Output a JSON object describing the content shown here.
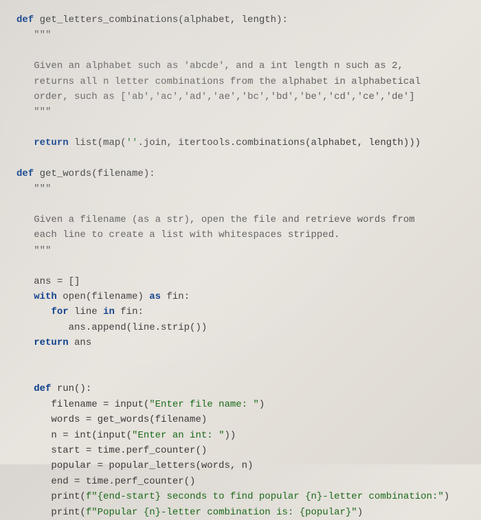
{
  "code": {
    "lines": [
      {
        "indent": 0,
        "tokens": [
          {
            "t": "def ",
            "c": "kw"
          },
          {
            "t": "get_letters_combinations(alphabet, length):",
            "c": "fn"
          }
        ]
      },
      {
        "indent": 1,
        "tokens": [
          {
            "t": "\"\"\"",
            "c": "docstr"
          }
        ]
      },
      {
        "indent": 0,
        "tokens": [
          {
            "t": "",
            "c": ""
          }
        ]
      },
      {
        "indent": 1,
        "tokens": [
          {
            "t": "Given an alphabet such as 'abcde', and a int length n such as 2,",
            "c": "docstr"
          }
        ]
      },
      {
        "indent": 1,
        "tokens": [
          {
            "t": "returns all n letter combinations from the alphabet in alphabetical",
            "c": "docstr"
          }
        ]
      },
      {
        "indent": 1,
        "tokens": [
          {
            "t": "order, such as ['ab','ac','ad','ae','bc','bd','be','cd','ce','de']",
            "c": "docstr"
          }
        ]
      },
      {
        "indent": 1,
        "tokens": [
          {
            "t": "\"\"\"",
            "c": "docstr"
          }
        ]
      },
      {
        "indent": 0,
        "tokens": [
          {
            "t": "",
            "c": ""
          }
        ]
      },
      {
        "indent": 1,
        "tokens": [
          {
            "t": "return ",
            "c": "kw"
          },
          {
            "t": "list(map(",
            "c": "fn"
          },
          {
            "t": "''",
            "c": "str"
          },
          {
            "t": ".join, itertools.combinations(alphabet, length)))",
            "c": "fn"
          }
        ]
      },
      {
        "indent": 0,
        "tokens": [
          {
            "t": "",
            "c": ""
          }
        ]
      },
      {
        "indent": 0,
        "tokens": [
          {
            "t": "def ",
            "c": "kw"
          },
          {
            "t": "get_words(filename):",
            "c": "fn"
          }
        ]
      },
      {
        "indent": 1,
        "tokens": [
          {
            "t": "\"\"\"",
            "c": "docstr"
          }
        ]
      },
      {
        "indent": 0,
        "tokens": [
          {
            "t": "",
            "c": ""
          }
        ]
      },
      {
        "indent": 1,
        "tokens": [
          {
            "t": "Given a filename (as a str), open the file and retrieve words from",
            "c": "docstr"
          }
        ]
      },
      {
        "indent": 1,
        "tokens": [
          {
            "t": "each line to create a list with whitespaces stripped.",
            "c": "docstr"
          }
        ]
      },
      {
        "indent": 1,
        "tokens": [
          {
            "t": "\"\"\"",
            "c": "docstr"
          }
        ]
      },
      {
        "indent": 0,
        "tokens": [
          {
            "t": "",
            "c": ""
          }
        ]
      },
      {
        "indent": 1,
        "tokens": [
          {
            "t": "ans = []",
            "c": "fn"
          }
        ]
      },
      {
        "indent": 1,
        "tokens": [
          {
            "t": "with ",
            "c": "kw"
          },
          {
            "t": "open(filename) ",
            "c": "fn"
          },
          {
            "t": "as ",
            "c": "kw"
          },
          {
            "t": "fin:",
            "c": "fn"
          }
        ]
      },
      {
        "indent": 2,
        "tokens": [
          {
            "t": "for ",
            "c": "kw"
          },
          {
            "t": "line ",
            "c": "fn"
          },
          {
            "t": "in ",
            "c": "kw"
          },
          {
            "t": "fin:",
            "c": "fn"
          }
        ]
      },
      {
        "indent": 3,
        "tokens": [
          {
            "t": "ans.append(line.strip())",
            "c": "fn"
          }
        ]
      },
      {
        "indent": 1,
        "tokens": [
          {
            "t": "return ",
            "c": "kw"
          },
          {
            "t": "ans",
            "c": "fn"
          }
        ]
      },
      {
        "indent": 0,
        "tokens": [
          {
            "t": "",
            "c": ""
          }
        ]
      },
      {
        "indent": 0,
        "tokens": [
          {
            "t": "",
            "c": ""
          }
        ]
      },
      {
        "indent": 1,
        "tokens": [
          {
            "t": "def ",
            "c": "kw"
          },
          {
            "t": "run():",
            "c": "fn"
          }
        ]
      },
      {
        "indent": 2,
        "tokens": [
          {
            "t": "filename = input(",
            "c": "fn"
          },
          {
            "t": "\"Enter file name: \"",
            "c": "str"
          },
          {
            "t": ")",
            "c": "fn"
          }
        ]
      },
      {
        "indent": 2,
        "tokens": [
          {
            "t": "words = get_words(filename)",
            "c": "fn"
          }
        ]
      },
      {
        "indent": 2,
        "tokens": [
          {
            "t": "n = int(input(",
            "c": "fn"
          },
          {
            "t": "\"Enter an int: \"",
            "c": "str"
          },
          {
            "t": "))",
            "c": "fn"
          }
        ]
      },
      {
        "indent": 2,
        "tokens": [
          {
            "t": "start = time.perf_counter()",
            "c": "fn"
          }
        ]
      },
      {
        "indent": 2,
        "tokens": [
          {
            "t": "popular = popular_letters(words, n)",
            "c": "fn"
          }
        ]
      },
      {
        "indent": 2,
        "tokens": [
          {
            "t": "end = time.perf_counter()",
            "c": "fn"
          }
        ]
      },
      {
        "indent": 2,
        "tokens": [
          {
            "t": "print(",
            "c": "fn"
          },
          {
            "t": "f\"{end-start} seconds to find popular {n}-letter combination:\"",
            "c": "str"
          },
          {
            "t": ")",
            "c": "fn"
          }
        ]
      },
      {
        "indent": 2,
        "tokens": [
          {
            "t": "print(",
            "c": "fn"
          },
          {
            "t": "f\"Popular {n}-letter combination is: {popular}\"",
            "c": "str"
          },
          {
            "t": ")",
            "c": "fn"
          }
        ]
      }
    ]
  }
}
